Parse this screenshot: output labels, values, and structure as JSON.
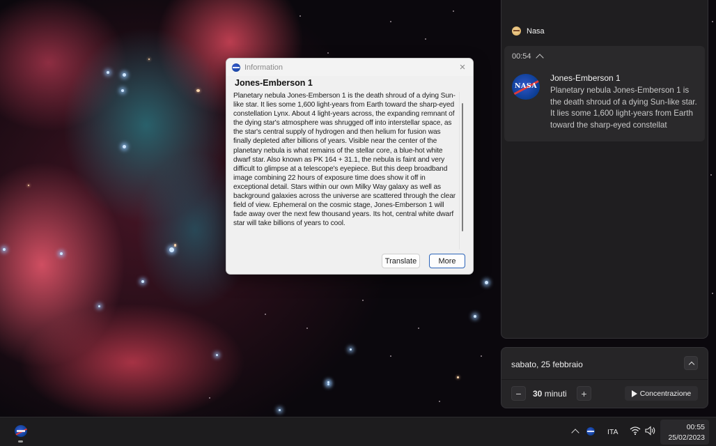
{
  "desktop": {
    "wallpaper": "Jones-Emberson 1 planetary nebula"
  },
  "dialog": {
    "title": "Information",
    "heading": "Jones-Emberson 1",
    "body": "Planetary nebula Jones-Emberson 1 is the death shroud of a dying Sun-like star. It lies some 1,600 light-years from Earth toward the sharp-eyed constellation Lynx. About 4 light-years across, the expanding remnant of the dying star's atmosphere was shrugged off into interstellar space, as the star's central supply of hydrogen and then helium for fusion was finally depleted after billions of years. Visible near the center of the planetary nebula is what remains of the stellar core, a blue-hot white dwarf star.  Also known as PK 164 + 31.1, the nebula is faint and very difficult to glimpse at a telescope's eyepiece. But this deep broadband image combining 22 hours of exposure time does show it off in exceptional detail. Stars within our own Milky Way galaxy as well as background galaxies across the universe are scattered through the clear field of view. Ephemeral on the cosmic stage, Jones-Emberson 1 will fade away over the next few thousand years. Its hot, central white dwarf star will take billions of years to cool.",
    "buttons": {
      "translate": "Translate",
      "more": "More"
    },
    "close_icon": "×"
  },
  "notification_center": {
    "app_name": "Nasa",
    "toast": {
      "time": "00:54",
      "logo_text": "NASA",
      "title": "Jones-Emberson 1",
      "body": "Planetary nebula Jones-Emberson 1 is the death shroud of a dying Sun-like star. It lies some 1,600 light-years from Earth toward the sharp-eyed constellat"
    }
  },
  "calendar": {
    "date": "sabato, 25 febbraio",
    "focus": {
      "minus": "−",
      "plus": "+",
      "value": "30",
      "unit": "minuti",
      "start_label": "Concentrazione"
    }
  },
  "taskbar": {
    "tray": {
      "language": "ITA",
      "time": "00:55",
      "date": "25/02/2023"
    }
  },
  "colors": {
    "accent": "#2a63b8",
    "dark_panel": "#1f1e20",
    "toast_bg": "#2a292b"
  }
}
